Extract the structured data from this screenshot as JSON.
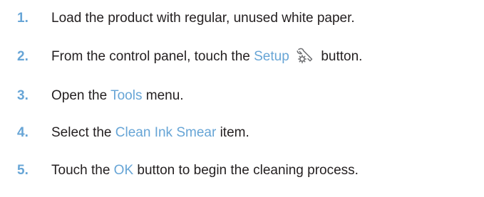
{
  "steps": [
    {
      "number": "1.",
      "text": "Load the product with regular, unused white paper."
    },
    {
      "number": "2.",
      "before": "From the control panel, touch the ",
      "term": "Setup",
      "after": " button.",
      "icon": "setup-wrench-gear-icon"
    },
    {
      "number": "3.",
      "before": "Open the ",
      "term": "Tools",
      "after": " menu."
    },
    {
      "number": "4.",
      "before": "Select the ",
      "term": "Clean Ink Smear",
      "after": " item."
    },
    {
      "number": "5.",
      "before": "Touch the ",
      "term": "OK",
      "after": " button to begin the cleaning process."
    }
  ],
  "colors": {
    "accent": "#67a5d6",
    "text": "#231f20",
    "icon": "#6d6e71"
  }
}
